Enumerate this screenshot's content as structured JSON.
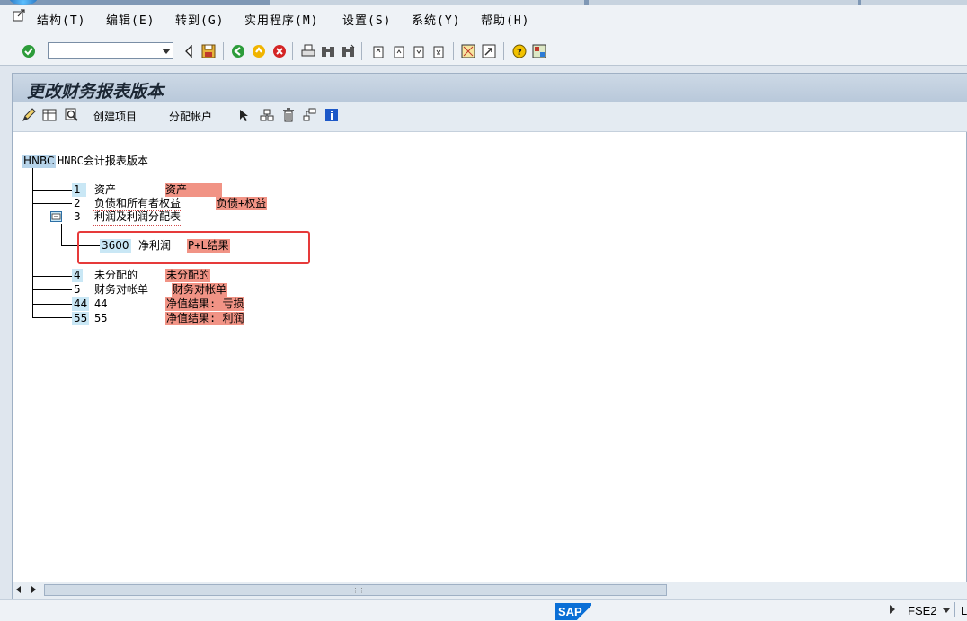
{
  "menu": {
    "items": [
      "结构(T)",
      "编辑(E)",
      "转到(G)",
      "实用程序(M)",
      "设置(S)",
      "系统(Y)",
      "帮助(H)"
    ]
  },
  "toolbar": {
    "command_value": ""
  },
  "page": {
    "title": "更改财务报表版本"
  },
  "app_toolbar": {
    "create_item_label": "创建项目",
    "assign_accounts_label": "分配帐户"
  },
  "tree": {
    "root": {
      "id": "HNBC",
      "text": "HNBC会计报表版本"
    },
    "nodes": [
      {
        "id": "1",
        "text": "资产",
        "tag": "资产"
      },
      {
        "id": "2",
        "text": "负债和所有者权益",
        "tag": "负债+权益"
      },
      {
        "id": "3",
        "text": "利润及利润分配表",
        "expanded": true
      },
      {
        "id": "3600",
        "text": "净利润",
        "tag": "P+L结果"
      },
      {
        "id": "4",
        "text": "未分配的",
        "tag": "未分配的"
      },
      {
        "id": "5",
        "text": "财务对帐单",
        "tag": "财务对帐单"
      },
      {
        "id": "44",
        "text": "44",
        "tag": "净值结果: 亏损"
      },
      {
        "id": "55",
        "text": "55",
        "tag": "净值结果: 利润"
      }
    ]
  },
  "status": {
    "logo": "SAP",
    "system": "FSE2",
    "trailing": "L"
  },
  "colors": {
    "tag_background": "#f19385",
    "highlight_frame": "#e63a3a"
  }
}
